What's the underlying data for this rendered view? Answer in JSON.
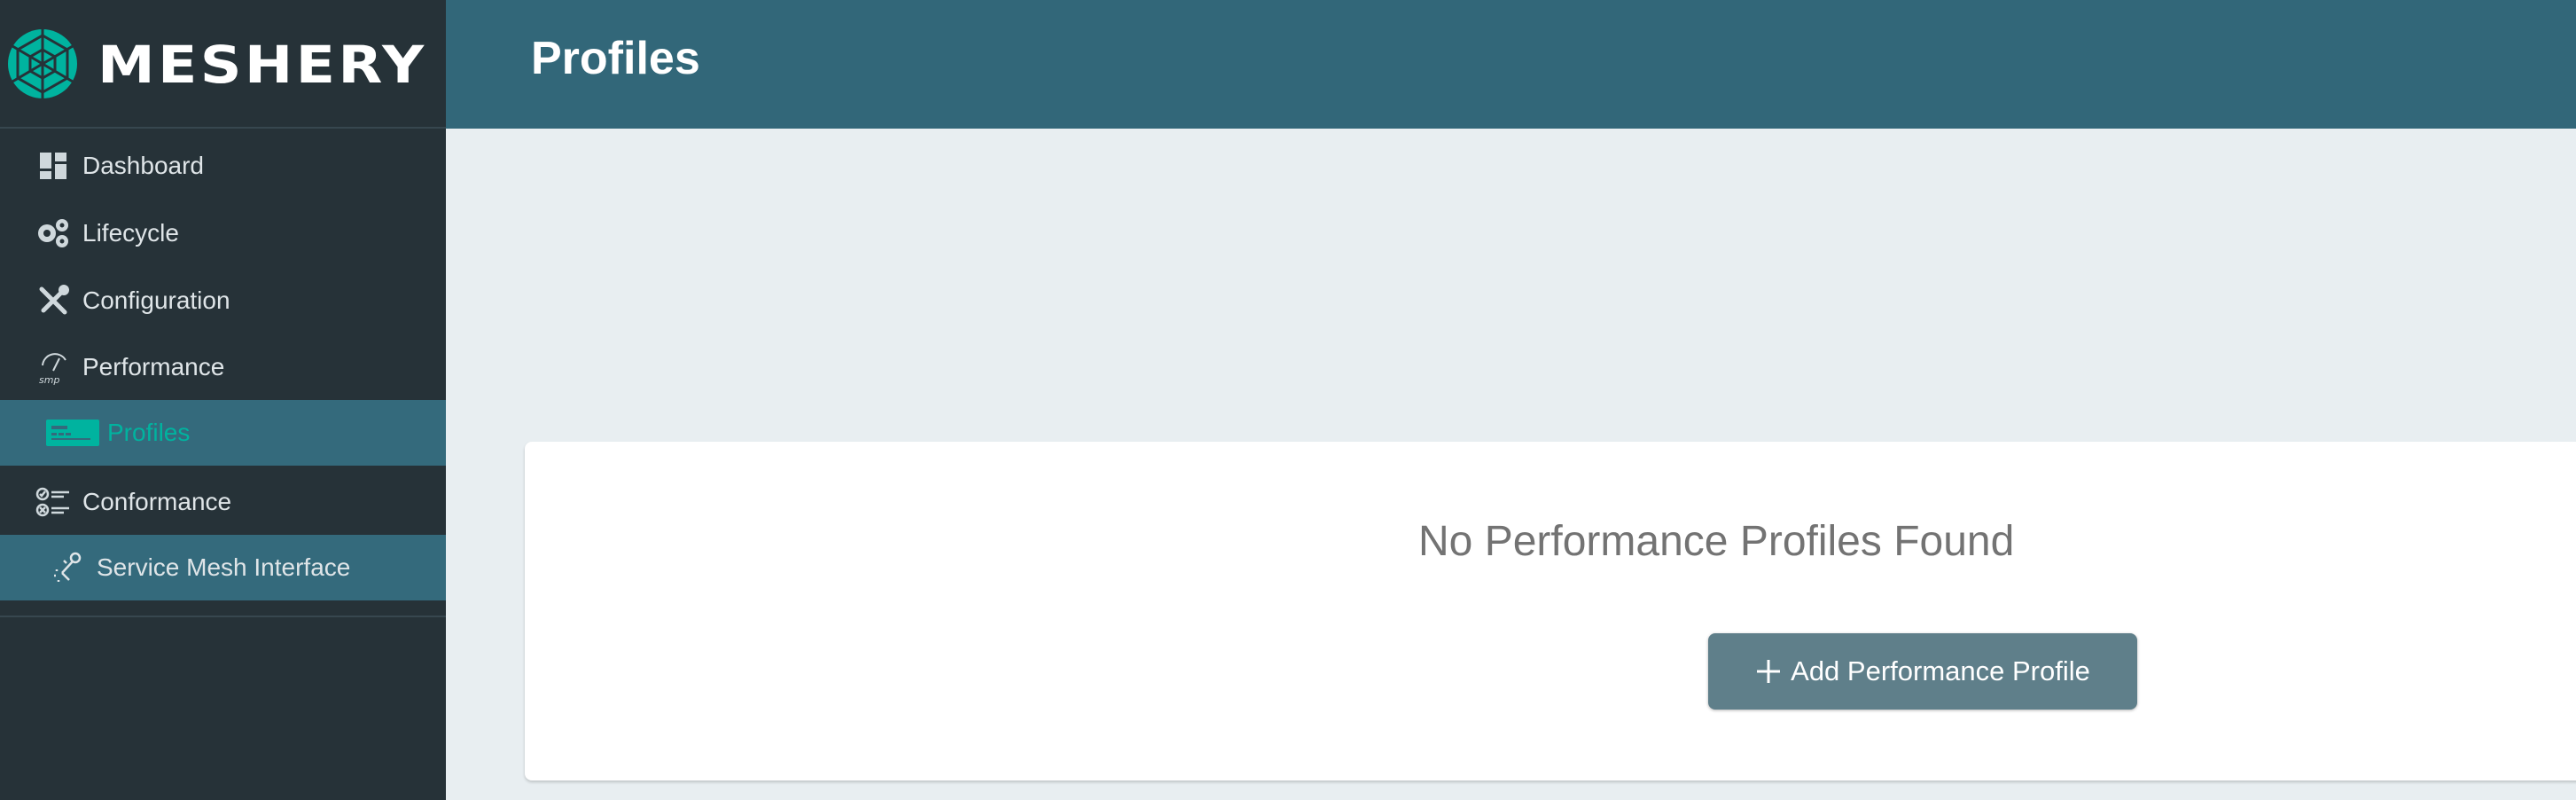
{
  "app": {
    "brand": "MESHERY"
  },
  "header": {
    "title": "Profiles"
  },
  "sidebar": {
    "items": [
      {
        "label": "Dashboard",
        "icon": "dashboard-icon"
      },
      {
        "label": "Lifecycle",
        "icon": "gears-icon"
      },
      {
        "label": "Configuration",
        "icon": "tools-icon"
      },
      {
        "label": "Performance",
        "icon": "smp-gauge-icon"
      },
      {
        "label": "Profiles",
        "icon": "profiles-icon",
        "active": true
      },
      {
        "label": "Conformance",
        "icon": "checklist-icon"
      },
      {
        "label": "Service Mesh Interface",
        "icon": "smi-icon",
        "selected": true
      }
    ]
  },
  "main": {
    "empty_message": "No Performance Profiles Found",
    "add_button_label": "Add Performance Profile"
  },
  "colors": {
    "sidebar_bg": "#263238",
    "header_bg": "#326779",
    "active_bg": "#346a7c",
    "accent": "#00b39f",
    "button_bg": "#5f7f8a",
    "page_bg": "#e8eef1"
  }
}
